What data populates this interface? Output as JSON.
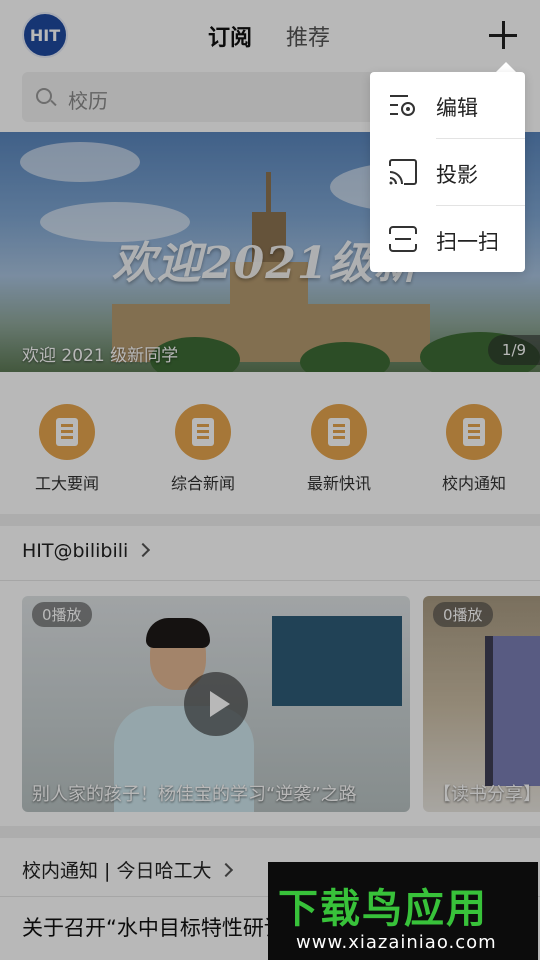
{
  "header": {
    "logo_text": "HIT",
    "tabs": [
      {
        "label": "订阅",
        "active": true
      },
      {
        "label": "推荐",
        "active": false
      }
    ]
  },
  "search": {
    "placeholder": "校历"
  },
  "banner": {
    "overlay_text": "欢迎2021级新",
    "caption": "欢迎 2021 级新同学",
    "index": "1/9"
  },
  "quick_links": [
    {
      "label": "工大要闻",
      "icon": "document-icon"
    },
    {
      "label": "综合新闻",
      "icon": "document-icon"
    },
    {
      "label": "最新快讯",
      "icon": "document-icon"
    },
    {
      "label": "校内通知",
      "icon": "document-icon"
    }
  ],
  "bilibili_section": {
    "title": "HIT@bilibili",
    "videos": [
      {
        "plays": "0播放",
        "title": "别人家的孩子！杨佳宝的学习“逆袭”之路"
      },
      {
        "plays": "0播放",
        "title": "【读书分享】"
      }
    ]
  },
  "notice_section": {
    "title": "校内通知 | 今日哈工大",
    "first_item": "关于召开“水中目标特性研讨会”的通知"
  },
  "popup_menu": {
    "items": [
      {
        "label": "编辑",
        "icon": "edit-icon"
      },
      {
        "label": "投影",
        "icon": "cast-icon"
      },
      {
        "label": "扫一扫",
        "icon": "scan-icon"
      }
    ]
  },
  "watermark": {
    "main": "下载鸟应用",
    "url": "www.xiazainiao.com"
  },
  "colors": {
    "accent_orange": "#e7a64e",
    "logo_blue": "#1f4aa0",
    "watermark_green": "#38c23a"
  }
}
